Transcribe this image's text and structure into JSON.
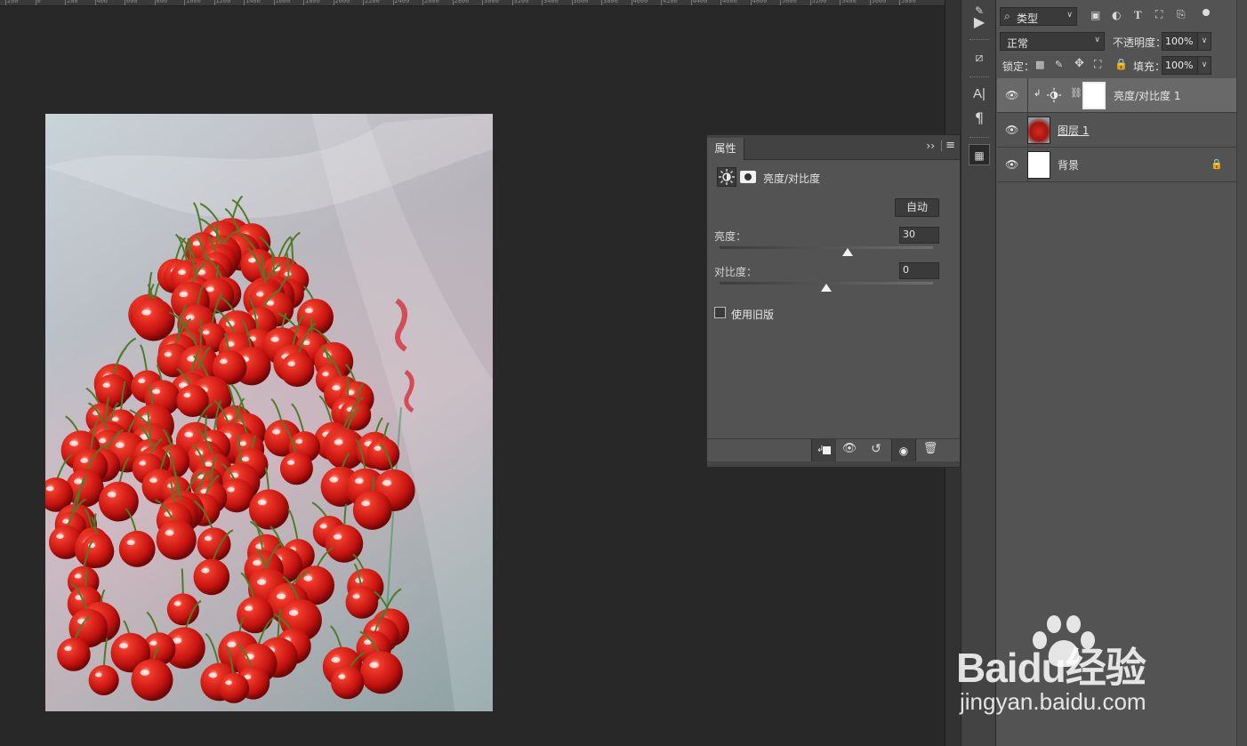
{
  "ruler": {
    "ticks": [
      "200",
      "0",
      "200",
      "400",
      "600",
      "800",
      "1000",
      "1200",
      "1400",
      "1600",
      "1800",
      "2000",
      "2200",
      "2400",
      "2600",
      "2800",
      "3000",
      "3200",
      "3400",
      "3600",
      "3800",
      "4000",
      "4200",
      "4400",
      "4600",
      "4800",
      "5000",
      "5200",
      "5400",
      "5600",
      "5800"
    ]
  },
  "properties_panel": {
    "tab_label": "属性",
    "adjustment_title": "亮度/对比度",
    "auto_button": "自动",
    "brightness_label": "亮度：",
    "brightness_value": "30",
    "brightness_fraction": 0.6,
    "contrast_label": "对比度：",
    "contrast_value": "0",
    "contrast_fraction": 0.5,
    "legacy_checkbox_label": "使用旧版",
    "legacy_checked": false
  },
  "layers_panel": {
    "filter_kind": "类型",
    "blend_mode": "正常",
    "opacity_label": "不透明度：",
    "opacity_value": "100%",
    "lock_label": "锁定：",
    "fill_label": "填充：",
    "fill_value": "100%",
    "layers": [
      {
        "name": "亮度/对比度 1",
        "type": "adjustment",
        "selected": true,
        "visible": true
      },
      {
        "name": "图层 1",
        "type": "image",
        "selected": false,
        "visible": true
      },
      {
        "name": "背景",
        "type": "background",
        "selected": false,
        "visible": true,
        "locked": true
      }
    ]
  },
  "watermark": {
    "brand": "Baidu经验",
    "url": "jingyan.baidu.com"
  },
  "colors": {
    "canvas_bg": "#282828",
    "panel_bg": "#535353",
    "selected_layer": "#696969"
  }
}
